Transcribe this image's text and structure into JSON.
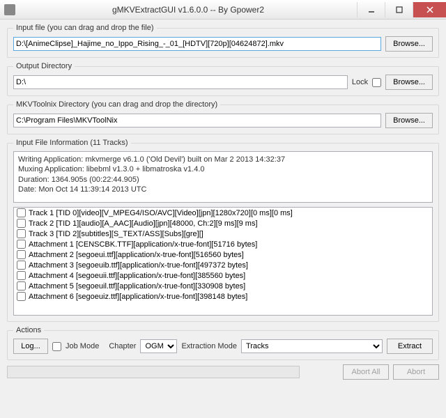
{
  "window": {
    "title": "gMKVExtractGUI v1.6.0.0 -- By Gpower2"
  },
  "inputFile": {
    "legend": "Input file (you can drag and drop the file)",
    "value": "D:\\[AnimeClipse]_Hajime_no_Ippo_Rising_-_01_[HDTV][720p][04624872].mkv",
    "browse": "Browse..."
  },
  "outputDir": {
    "legend": "Output Directory",
    "value": "D:\\",
    "lockLabel": "Lock",
    "browse": "Browse..."
  },
  "toolnixDir": {
    "legend": "MKVToolnix Directory (you can drag and drop the directory)",
    "value": "C:\\Program Files\\MKVToolNix",
    "browse": "Browse..."
  },
  "fileInfo": {
    "legend": "Input File Information (11 Tracks)",
    "lines": [
      "Writing Application: mkvmerge v6.1.0 ('Old Devil') built on Mar  2 2013 14:32:37",
      "Muxing Application: libebml v1.3.0 + libmatroska v1.4.0",
      "Duration: 1364.905s (00:22:44.905)",
      "Date: Mon Oct 14 11:39:14 2013 UTC"
    ],
    "tracks": [
      "Track 1 [TID 0][video][V_MPEG4/ISO/AVC][Video][jpn][1280x720][0 ms][0 ms]",
      "Track 2 [TID 1][audio][A_AAC][Audio][jpn][48000, Ch:2][9 ms][9 ms]",
      "Track 3 [TID 2][subtitles][S_TEXT/ASS][Subs][gre][]",
      "Attachment 1 [CENSCBK.TTF][application/x-true-font][51716 bytes]",
      "Attachment 2 [segoeui.ttf][application/x-true-font][516560 bytes]",
      "Attachment 3 [segoeuib.ttf][application/x-true-font][497372 bytes]",
      "Attachment 4 [segoeuii.ttf][application/x-true-font][385560 bytes]",
      "Attachment 5 [segoeuil.ttf][application/x-true-font][330908 bytes]",
      "Attachment 6 [segoeuiz.ttf][application/x-true-font][398148 bytes]"
    ]
  },
  "actions": {
    "legend": "Actions",
    "log": "Log...",
    "jobMode": "Job Mode",
    "chapterLabel": "Chapter",
    "chapterValue": "OGM",
    "extractModeLabel": "Extraction Mode",
    "extractModeValue": "Tracks",
    "extract": "Extract"
  },
  "footer": {
    "abortAll": "Abort All",
    "abort": "Abort"
  }
}
